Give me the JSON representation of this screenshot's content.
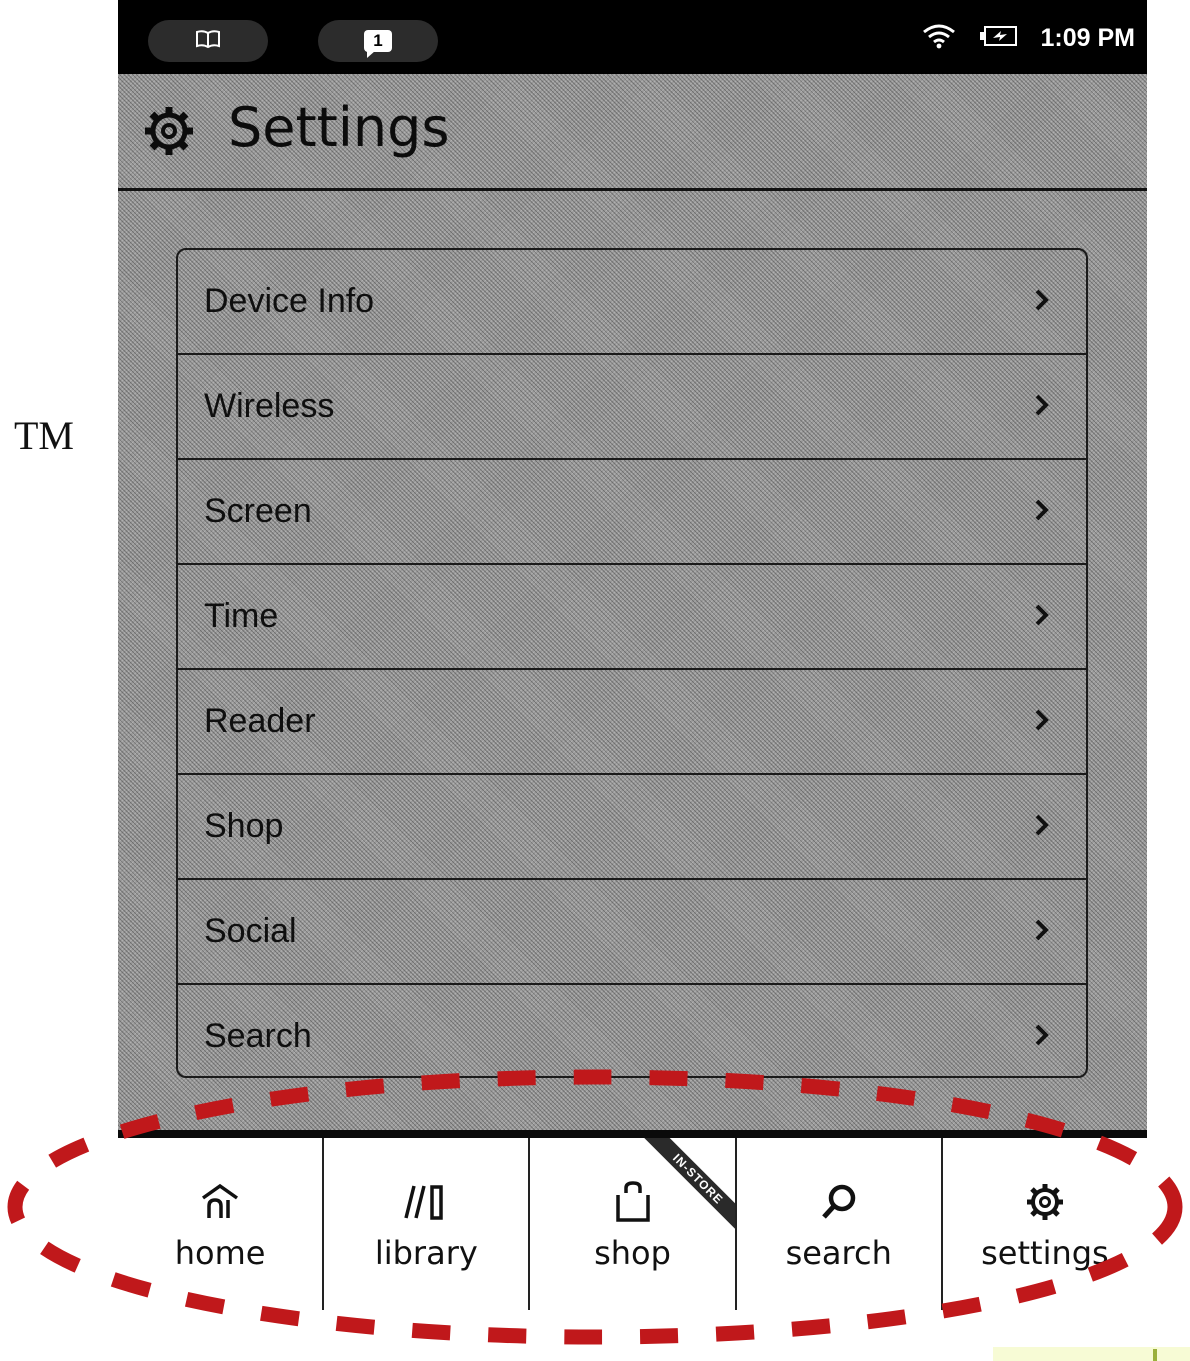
{
  "trademark": "TM",
  "status_bar": {
    "book_icon": "book-icon",
    "notification_count": "1",
    "wifi_icon": "wifi-icon",
    "battery_icon": "battery-charging-icon",
    "time": "1:09 PM"
  },
  "header": {
    "icon": "gear-icon",
    "title": "Settings"
  },
  "settings_menu": {
    "items": [
      {
        "label": "Device Info"
      },
      {
        "label": "Wireless"
      },
      {
        "label": "Screen"
      },
      {
        "label": "Time"
      },
      {
        "label": "Reader"
      },
      {
        "label": "Shop"
      },
      {
        "label": "Social"
      },
      {
        "label": "Search"
      }
    ]
  },
  "nav": {
    "items": [
      {
        "label": "home",
        "icon": "home-icon"
      },
      {
        "label": "library",
        "icon": "library-icon"
      },
      {
        "label": "shop",
        "icon": "shopping-bag-icon",
        "ribbon": "IN-STORE"
      },
      {
        "label": "search",
        "icon": "search-icon"
      },
      {
        "label": "settings",
        "icon": "gear-icon"
      }
    ]
  },
  "colors": {
    "highlight_dash": "#c0181b",
    "status_bar_bg": "#000000",
    "screen_bg": "#9a9a9a"
  }
}
